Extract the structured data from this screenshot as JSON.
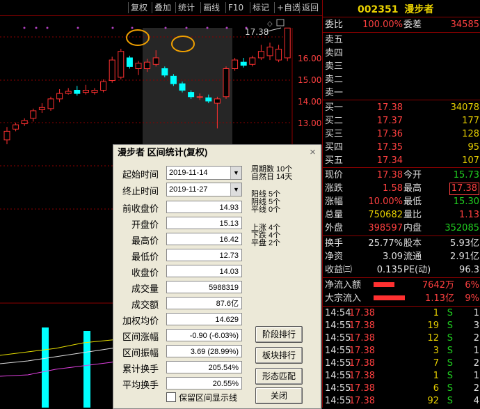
{
  "toolbar": {
    "items": [
      "复权",
      "叠加",
      "统计",
      "画线",
      "F10",
      "标记",
      "+自选",
      "返回"
    ]
  },
  "chart": {
    "price_labels": [
      "16.00",
      "15.00",
      "14.00",
      "13.00"
    ],
    "high_label": "17.38",
    "candles": [
      {
        "o": 12.2,
        "c": 12.6,
        "h": 12.8,
        "l": 12.0
      },
      {
        "o": 12.7,
        "c": 12.9,
        "h": 13.0,
        "l": 12.6
      },
      {
        "o": 12.95,
        "c": 13.1,
        "h": 13.2,
        "l": 12.85
      },
      {
        "o": 13.2,
        "c": 13.55,
        "h": 13.65,
        "l": 13.05
      },
      {
        "o": 13.6,
        "c": 13.7,
        "h": 13.9,
        "l": 13.45
      },
      {
        "o": 13.65,
        "c": 14.1,
        "h": 14.2,
        "l": 13.55
      },
      {
        "o": 14.1,
        "c": 14.35,
        "h": 14.55,
        "l": 13.95
      },
      {
        "o": 14.35,
        "c": 14.45,
        "h": 14.6,
        "l": 14.3
      },
      {
        "o": 14.5,
        "c": 14.35,
        "h": 14.7,
        "l": 14.25
      },
      {
        "o": 14.4,
        "c": 14.5,
        "h": 14.75,
        "l": 14.3
      },
      {
        "o": 14.4,
        "c": 14.5,
        "h": 14.6,
        "l": 14.3
      },
      {
        "o": 14.5,
        "c": 14.9,
        "h": 15.0,
        "l": 14.4
      },
      {
        "o": 14.95,
        "c": 15.9,
        "h": 16.05,
        "l": 14.85
      },
      {
        "o": 15.1,
        "c": 16.3,
        "h": 16.42,
        "l": 15.0
      },
      {
        "o": 16.0,
        "c": 15.6,
        "h": 16.1,
        "l": 15.5
      },
      {
        "o": 15.5,
        "c": 15.75,
        "h": 15.85,
        "l": 15.2
      },
      {
        "o": 15.5,
        "c": 15.8,
        "h": 15.95,
        "l": 15.35
      },
      {
        "o": 15.7,
        "c": 16.0,
        "h": 16.35,
        "l": 15.6
      },
      {
        "o": 15.5,
        "c": 15.2,
        "h": 15.6,
        "l": 15.1
      },
      {
        "o": 15.15,
        "c": 14.8,
        "h": 15.25,
        "l": 14.7
      },
      {
        "o": 14.8,
        "c": 14.5,
        "h": 14.9,
        "l": 14.4
      },
      {
        "o": 14.4,
        "c": 14.2,
        "h": 14.5,
        "l": 14.1
      },
      {
        "o": 14.2,
        "c": 14.2,
        "h": 14.35,
        "l": 14.05
      },
      {
        "o": 14.15,
        "c": 14.0,
        "h": 14.3,
        "l": 13.9
      },
      {
        "o": 13.9,
        "c": 14.1,
        "h": 14.2,
        "l": 12.73
      },
      {
        "o": 14.2,
        "c": 15.5,
        "h": 15.6,
        "l": 14.1
      },
      {
        "o": 15.5,
        "c": 15.9,
        "h": 16.0,
        "l": 15.4
      },
      {
        "o": 15.8,
        "c": 15.65,
        "h": 16.0,
        "l": 15.55
      },
      {
        "o": 15.7,
        "c": 16.0,
        "h": 16.1,
        "l": 15.6
      },
      {
        "o": 16.0,
        "c": 16.3,
        "h": 16.6,
        "l": 15.9
      },
      {
        "o": 16.1,
        "c": 16.5,
        "h": 16.7,
        "l": 15.9
      },
      {
        "o": 15.9,
        "c": 16.4,
        "h": 16.6,
        "l": 15.8
      },
      {
        "o": 16.0,
        "c": 17.38,
        "h": 17.38,
        "l": 15.85
      }
    ]
  },
  "panel": {
    "code": "002351",
    "name": "漫步者",
    "weibi_label": "委比",
    "weibi_value": "100.00%",
    "weicha_label": "委差",
    "weicha_value": "34585",
    "asks": [
      {
        "label": "卖五",
        "price": "",
        "vol": ""
      },
      {
        "label": "卖四",
        "price": "",
        "vol": ""
      },
      {
        "label": "卖三",
        "price": "",
        "vol": ""
      },
      {
        "label": "卖二",
        "price": "",
        "vol": ""
      },
      {
        "label": "卖一",
        "price": "",
        "vol": ""
      }
    ],
    "bids": [
      {
        "label": "买一",
        "price": "17.38",
        "vol": "34078"
      },
      {
        "label": "买二",
        "price": "17.37",
        "vol": "177"
      },
      {
        "label": "买三",
        "price": "17.36",
        "vol": "128"
      },
      {
        "label": "买四",
        "price": "17.35",
        "vol": "95"
      },
      {
        "label": "买五",
        "price": "17.34",
        "vol": "107"
      }
    ],
    "quote": [
      {
        "l1": "现价",
        "v1": "17.38",
        "c1": "red",
        "l2": "今开",
        "v2": "15.73",
        "c2": "grn"
      },
      {
        "l1": "涨跌",
        "v1": "1.58",
        "c1": "red",
        "l2": "最高",
        "v2": "17.38",
        "c2": "red"
      },
      {
        "l1": "涨幅",
        "v1": "10.00%",
        "c1": "red",
        "l2": "最低",
        "v2": "15.30",
        "c2": "grn"
      },
      {
        "l1": "总量",
        "v1": "750682",
        "c1": "yel",
        "l2": "量比",
        "v2": "1.13",
        "c2": "red"
      },
      {
        "l1": "外盘",
        "v1": "398597",
        "c1": "red",
        "l2": "内盘",
        "v2": "352085",
        "c2": "grn"
      }
    ],
    "quote2": [
      {
        "l1": "换手",
        "v1": "25.77%",
        "l2": "股本",
        "v2": "5.93亿"
      },
      {
        "l1": "净资",
        "v1": "3.09",
        "l2": "流通",
        "v2": "2.91亿"
      },
      {
        "l1": "收益㈢",
        "v1": "0.135",
        "l2": "PE(动)",
        "v2": "96.3"
      }
    ],
    "flows": [
      {
        "label": "净流入额",
        "value": "7642万",
        "pct": "6%",
        "bar": 0.6
      },
      {
        "label": "大宗流入",
        "value": "1.13亿",
        "pct": "9%",
        "bar": 0.9
      }
    ],
    "ticks": [
      {
        "t": "14:54",
        "p": "17.38",
        "v": "1",
        "s": "S",
        "n": "1"
      },
      {
        "t": "14:55",
        "p": "17.38",
        "v": "19",
        "s": "S",
        "n": "3"
      },
      {
        "t": "14:55",
        "p": "17.38",
        "v": "12",
        "s": "S",
        "n": "2"
      },
      {
        "t": "14:55",
        "p": "17.38",
        "v": "3",
        "s": "S",
        "n": "1"
      },
      {
        "t": "14:55",
        "p": "17.38",
        "v": "7",
        "s": "S",
        "n": "2"
      },
      {
        "t": "14:55",
        "p": "17.38",
        "v": "1",
        "s": "S",
        "n": "1"
      },
      {
        "t": "14:55",
        "p": "17.38",
        "v": "6",
        "s": "S",
        "n": "2"
      },
      {
        "t": "14:55",
        "p": "17.38",
        "v": "92",
        "s": "S",
        "n": "4"
      }
    ]
  },
  "dialog": {
    "title": "漫步者 区间统计(复权)",
    "start_label": "起始时间",
    "start_value": "2019-11-14",
    "end_label": "终止时间",
    "end_value": "2019-11-27",
    "fields": [
      {
        "label": "前收盘价",
        "value": "14.93"
      },
      {
        "label": "开盘价",
        "value": "15.13"
      },
      {
        "label": "最高价",
        "value": "16.42"
      },
      {
        "label": "最低价",
        "value": "12.73"
      },
      {
        "label": "收盘价",
        "value": "14.03"
      },
      {
        "label": "成交量",
        "value": "5988319"
      },
      {
        "label": "成交额",
        "value": "87.6亿"
      },
      {
        "label": "加权均价",
        "value": "14.629"
      },
      {
        "label": "区间涨幅",
        "value": "-0.90 (-6.03%)"
      },
      {
        "label": "区间振幅",
        "value": "3.69 (28.99%)"
      },
      {
        "label": "累计换手",
        "value": "205.54%"
      },
      {
        "label": "平均换手",
        "value": "20.55%"
      }
    ],
    "stats": {
      "zhouqi": "周期数 10个",
      "ziran": "自然日 14天",
      "yang": "阳线 5个",
      "yin": "阴线 5个",
      "ping": "平线 0个",
      "up": "上涨 4个",
      "down": "下跌 4个",
      "flat": "平盘 2个"
    },
    "buttons": [
      "阶段排行",
      "板块排行",
      "形态匹配",
      "关闭"
    ],
    "checkbox_label": "保留区间显示线"
  }
}
